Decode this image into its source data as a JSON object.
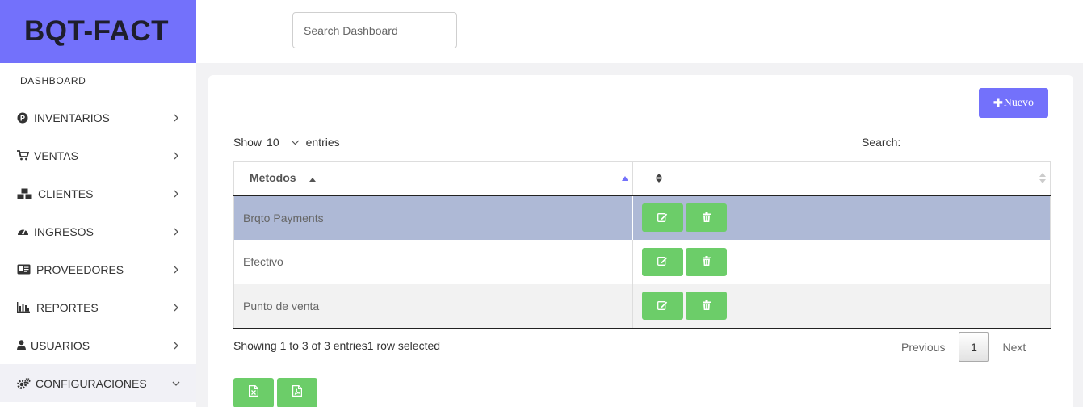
{
  "brand": {
    "title": "BQT-FACT",
    "color": "#7371fb"
  },
  "search": {
    "placeholder": "Search Dashboard"
  },
  "sidebar": {
    "dashboard_label": "DASHBOARD",
    "items": [
      {
        "label": "INVENTARIOS",
        "icon": "p-circle-icon"
      },
      {
        "label": "VENTAS",
        "icon": "cart-icon"
      },
      {
        "label": "CLIENTES",
        "icon": "cubes-icon"
      },
      {
        "label": "INGRESOS",
        "icon": "gauge-icon"
      },
      {
        "label": "PROVEEDORES",
        "icon": "id-card-icon"
      },
      {
        "label": "REPORTES",
        "icon": "bar-chart-icon"
      },
      {
        "label": "USUARIOS",
        "icon": "user-icon"
      },
      {
        "label": "CONFIGURACIONES",
        "icon": "cogs-icon"
      }
    ]
  },
  "main": {
    "new_button": "Nuevo",
    "show_label": "Show",
    "entries_value": "10",
    "entries_label": "entries",
    "search_label": "Search:",
    "table": {
      "columns": [
        "Metodos",
        ""
      ],
      "rows": [
        {
          "metodo": "Brqto Payments"
        },
        {
          "metodo": "Efectivo"
        },
        {
          "metodo": "Punto de venta"
        }
      ]
    },
    "info": "Showing 1 to 3 of 3 entries1 row selected",
    "pagination": {
      "previous": "Previous",
      "current_page": "1",
      "next": "Next"
    }
  },
  "colors": {
    "accent": "#7371fb",
    "action_green": "#6ccd69",
    "selected_row": "#aeb9d6"
  }
}
